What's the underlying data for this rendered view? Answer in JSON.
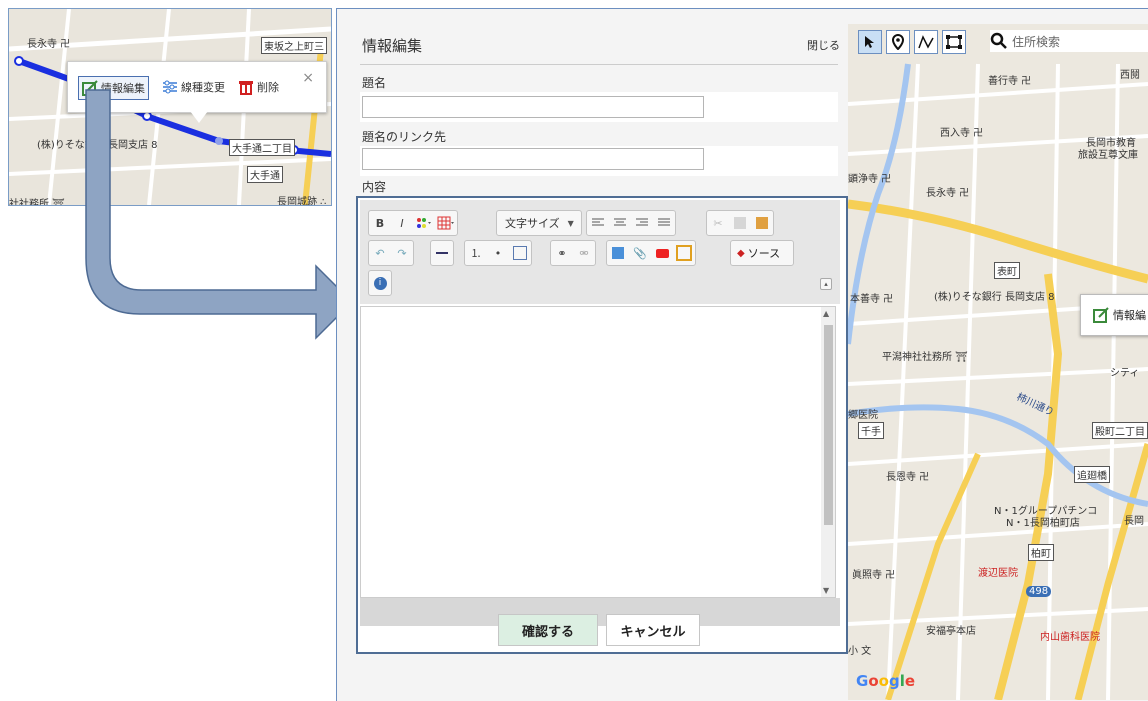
{
  "thumbnail": {
    "labels": {
      "chojiji": "長永寺 卍",
      "higashisaka": "東坂之上町三",
      "resona": "(株)りそな銀行 長岡支店 8",
      "ote2": "大手通二丁目",
      "ote": "大手通",
      "shrine": "社社務所 ⛩",
      "castle": "長岡城跡 ∴"
    },
    "popup": {
      "edit": "情報編集",
      "linetype": "線種変更",
      "delete": "削除",
      "close": "×"
    }
  },
  "form": {
    "title": "情報編集",
    "close": "閉じる",
    "field_title": "題名",
    "field_title_value": "",
    "field_link": "題名のリンク先",
    "field_link_value": "",
    "field_content": "内容",
    "font_size_label": "文字サイズ",
    "source_label": "ソース",
    "confirm": "確認する",
    "cancel": "キャンセル"
  },
  "map": {
    "search_placeholder": "住所検索",
    "popup_label": "情報編",
    "google": "Google",
    "places": {
      "zengyoji": "善行寺 卍",
      "nishiiriji": "西入寺 卍",
      "kyoiku": "長岡市教育",
      "bunko": "旅設互尊文庫",
      "kenjoji": "顕浄寺 卍",
      "choeiji": "長永寺 卍",
      "omotemachi": "表町",
      "motobanji": "本善寺 卍",
      "resona": "(株)りそな銀行 長岡支店 8",
      "hirakata": "平潟神社社務所 ⛩",
      "city": "シティ",
      "iin": "郷医院",
      "senju": "千手",
      "kakigawa": "柿川通り",
      "tonomachi": "殿町二丁目",
      "chogenji": "長恩寺 卍",
      "tsuihashi": "追廻橋",
      "pachinko1": "N・1グループパチンコ",
      "pachinko2": "N・1長岡柏町店",
      "nagao": "長岡",
      "shinshoji": "眞照寺 卍",
      "kashiwamachi": "柏町",
      "watanabe": "渡辺医院",
      "route": "498",
      "anfukutei": "安福亭本店",
      "uchiyama": "内山歯科医院",
      "nishi": "西鬩",
      "sho": "小 文"
    }
  }
}
